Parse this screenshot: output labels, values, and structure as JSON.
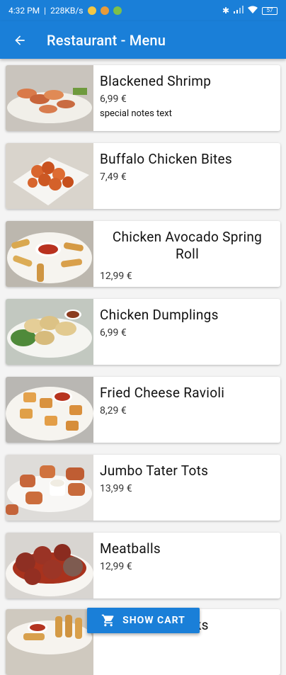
{
  "status": {
    "time": "4:32 PM",
    "speed": "228KB/s",
    "battery": "57"
  },
  "appbar": {
    "title": "Restaurant - Menu"
  },
  "items": [
    {
      "name": "Blackened Shrimp",
      "price": "6,99 €",
      "notes": "special notes text"
    },
    {
      "name": "Buffalo Chicken Bites",
      "price": "7,49 €"
    },
    {
      "name": "Chicken Avocado Spring Roll",
      "price": "12,99 €"
    },
    {
      "name": "Chicken Dumplings",
      "price": "6,99 €"
    },
    {
      "name": "Fried Cheese Ravioli",
      "price": "8,29 €"
    },
    {
      "name": "Jumbo Tater Tots",
      "price": "13,99 €"
    },
    {
      "name": "Meatballs",
      "price": "12,99 €"
    },
    {
      "name": "Mozzarella Sticks"
    }
  ],
  "cart_button": {
    "label": "SHOW CART"
  },
  "colors": {
    "primary": "#1a7fd8",
    "background": "#f4f4f4",
    "card": "#ffffff"
  }
}
